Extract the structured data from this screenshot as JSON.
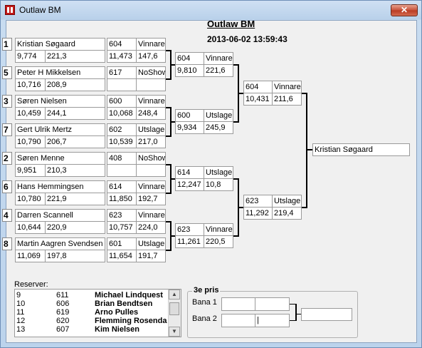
{
  "window": {
    "title": "Outlaw BM",
    "close_label": "✕"
  },
  "heading": "Outlaw BM",
  "datetime": "2013-06-02 13:59:43",
  "round1": [
    {
      "seed": "1",
      "name": "Kristian Søgaard",
      "v1": "9,774",
      "v2": "221,3",
      "time": "604",
      "status": "Vinnare",
      "r1": "11,473",
      "r2": "147,6"
    },
    {
      "seed": "5",
      "name": "Peter H Mikkelsen",
      "v1": "10,716",
      "v2": "208,9",
      "time": "617",
      "status": "NoShow",
      "r1": "",
      "r2": ""
    },
    {
      "seed": "3",
      "name": "Søren Nielsen",
      "v1": "10,459",
      "v2": "244,1",
      "time": "600",
      "status": "Vinnare",
      "r1": "10,068",
      "r2": "248,4"
    },
    {
      "seed": "7",
      "name": "Gert Ulrik Mertz",
      "v1": "10,790",
      "v2": "206,7",
      "time": "602",
      "status": "Utslagen",
      "r1": "10,539",
      "r2": "217,0"
    },
    {
      "seed": "2",
      "name": "Søren Menne",
      "v1": "9,951",
      "v2": "210,3",
      "time": "408",
      "status": "NoShow",
      "r1": "",
      "r2": ""
    },
    {
      "seed": "6",
      "name": "Hans Hemmingsen",
      "v1": "10,780",
      "v2": "221,9",
      "time": "614",
      "status": "Vinnare",
      "r1": "11,850",
      "r2": "192,7"
    },
    {
      "seed": "4",
      "name": "Darren Scannell",
      "v1": "10,644",
      "v2": "220,9",
      "time": "623",
      "status": "Vinnare",
      "r1": "10,757",
      "r2": "224,0"
    },
    {
      "seed": "8",
      "name": "Martin Aagren Svendsen",
      "v1": "11,069",
      "v2": "197,8",
      "time": "601",
      "status": "Utslagen",
      "r1": "11,654",
      "r2": "191,7"
    }
  ],
  "round2": [
    {
      "time": "604",
      "status": "Vinnare",
      "r1": "9,810",
      "r2": "221,6"
    },
    {
      "time": "600",
      "status": "Utslagen",
      "r1": "9,934",
      "r2": "245,9"
    },
    {
      "time": "614",
      "status": "Utslagen",
      "r1": "12,247",
      "r2": "10,8"
    },
    {
      "time": "623",
      "status": "Vinnare",
      "r1": "11,261",
      "r2": "220,5"
    }
  ],
  "round3": [
    {
      "time": "604",
      "status": "Vinnare",
      "r1": "10,431",
      "r2": "211,6"
    },
    {
      "time": "623",
      "status": "Utslagen",
      "r1": "11,292",
      "r2": "219,4"
    }
  ],
  "winner": "Kristian Søgaard",
  "reserves": {
    "label": "Reserver:",
    "rows": [
      {
        "num": "9",
        "id": "611",
        "name": "Michael Lindquest"
      },
      {
        "num": "10",
        "id": "606",
        "name": "Brian Bendtsen"
      },
      {
        "num": "11",
        "id": "619",
        "name": "Arno Pulles"
      },
      {
        "num": "12",
        "id": "620",
        "name": "Flemming Rosenda"
      },
      {
        "num": "13",
        "id": "607",
        "name": "Kim Nielsen"
      }
    ]
  },
  "third_prize": {
    "title": "3e pris",
    "bana1": "Bana 1",
    "bana2": "Bana 2",
    "cursor": "|"
  }
}
